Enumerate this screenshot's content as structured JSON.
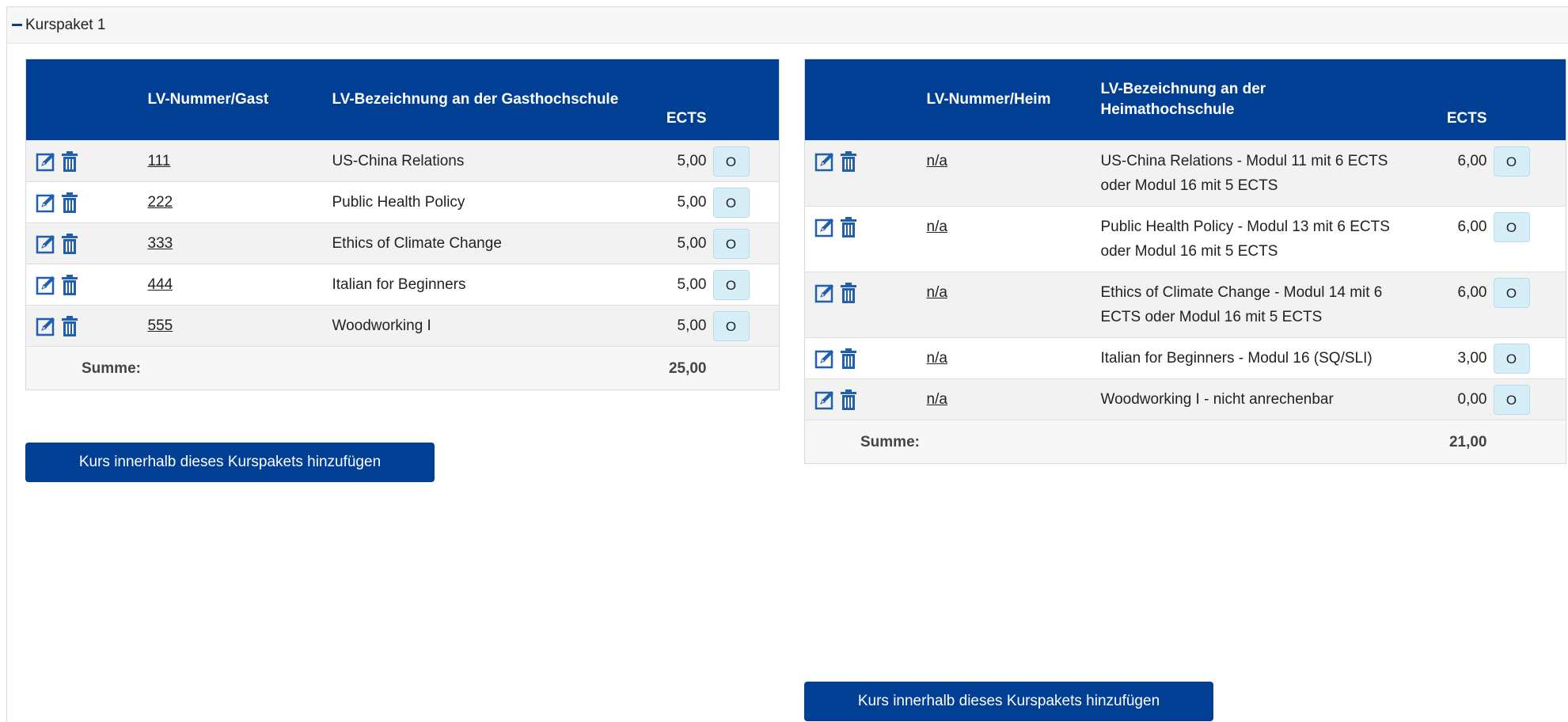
{
  "package": {
    "title": "Kurspaket 1"
  },
  "guest_table": {
    "headers": {
      "number": "LV-Nummer/Gast",
      "description": "LV-Bezeichnung an der Gasthochschule",
      "ects": "ECTS"
    },
    "rows": [
      {
        "number": "111",
        "description": "US-China Relations",
        "ects": "5,00",
        "status": "O"
      },
      {
        "number": "222",
        "description": "Public Health Policy",
        "ects": "5,00",
        "status": "O"
      },
      {
        "number": "333",
        "description": "Ethics of Climate Change",
        "ects": "5,00",
        "status": "O"
      },
      {
        "number": "444",
        "description": "Italian for Beginners",
        "ects": "5,00",
        "status": "O"
      },
      {
        "number": "555",
        "description": "Woodworking I",
        "ects": "5,00",
        "status": "O"
      }
    ],
    "sum_label": "Summe:",
    "sum_value": "25,00",
    "add_label": "Kurs innerhalb dieses Kurspakets hinzufügen"
  },
  "home_table": {
    "headers": {
      "number": "LV-Nummer/Heim",
      "description": "LV-Bezeichnung an der Heimathochschule",
      "ects": "ECTS"
    },
    "rows": [
      {
        "number": "n/a",
        "description": "US-China Relations - Modul 11 mit 6 ECTS oder Modul 16 mit 5 ECTS",
        "ects": "6,00",
        "status": "O"
      },
      {
        "number": "n/a",
        "description": "Public Health Policy - Modul 13 mit 6 ECTS oder Modul 16 mit 5 ECTS",
        "ects": "6,00",
        "status": "O"
      },
      {
        "number": "n/a",
        "description": "Ethics of Climate Change - Modul 14 mit 6 ECTS oder Modul 16 mit 5 ECTS",
        "ects": "6,00",
        "status": "O"
      },
      {
        "number": "n/a",
        "description": "Italian for Beginners - Modul 16 (SQ/SLI)",
        "ects": "3,00",
        "status": "O"
      },
      {
        "number": "n/a",
        "description": "Woodworking I - nicht anrechenbar",
        "ects": "0,00",
        "status": "O"
      }
    ],
    "sum_label": "Summe:",
    "sum_value": "21,00",
    "add_label": "Kurs innerhalb dieses Kurspakets hinzufügen"
  },
  "icons": {
    "edit": "edit-icon",
    "delete": "trash-icon",
    "collapse": "minus-icon"
  },
  "colors": {
    "header_blue": "#003f94",
    "status_button": "#d5eef7"
  }
}
